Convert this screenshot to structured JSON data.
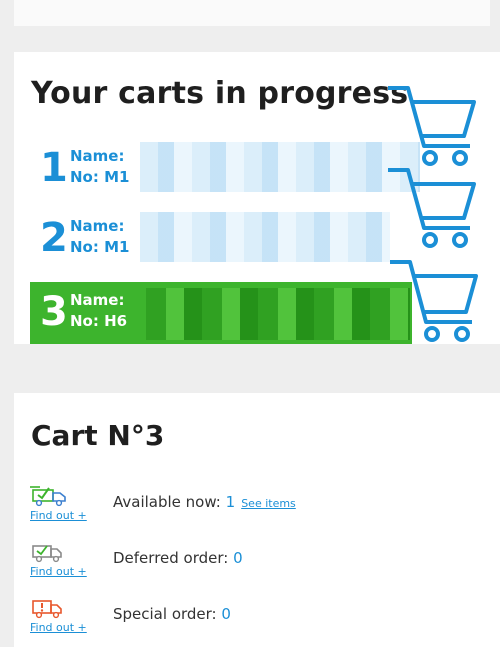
{
  "carts_panel": {
    "title": "Your carts in progress",
    "carts": [
      {
        "index": "1",
        "name_label": "Name:",
        "no_label": "No: M1"
      },
      {
        "index": "2",
        "name_label": "Name:",
        "no_label": "No: M1"
      },
      {
        "index": "3",
        "name_label": "Name:",
        "no_label": "No: H6"
      }
    ]
  },
  "cart_panel": {
    "title": "Cart N°3",
    "statuses": [
      {
        "label": "Available now:",
        "count": "1",
        "see_items": "See items",
        "find_out": "Find out +",
        "icon": "truck-check-icon",
        "color": "#3db42d"
      },
      {
        "label": "Deferred order:",
        "count": "0",
        "find_out": "Find out +",
        "icon": "truck-deferred-icon",
        "color": "#8a8a8a"
      },
      {
        "label": "Special order:",
        "count": "0",
        "find_out": "Find out +",
        "icon": "truck-alert-icon",
        "color": "#e8572c"
      }
    ]
  },
  "colors": {
    "accent_blue": "#1b8fd6",
    "selected_green": "#3db42d"
  }
}
